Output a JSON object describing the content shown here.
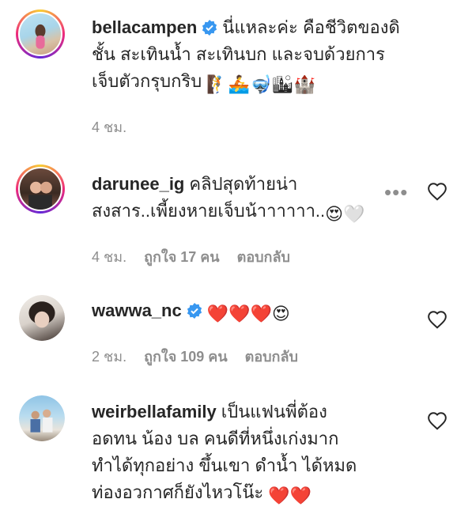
{
  "comments": [
    {
      "username": "bellacampen",
      "verified": true,
      "lines": [
        "นี่แหละค่ะ คือชีวิตของดิ",
        "ชั้น สะเทินน้ำ สะเทินบก และจบด้วยการ",
        "เจ็บตัวกรุบกริบ"
      ],
      "emoji_after": "🧗🚣🤿🏙🏰",
      "time": "4 ชม.",
      "likes": "",
      "reply": ""
    },
    {
      "username": "darunee_ig",
      "verified": false,
      "lines": [
        "คลิปสุดท้ายน่า",
        "สงสาร..เพี้ยงหายเจ็บน้าาาาาา.."
      ],
      "emoji_after": "😍🤍",
      "time": "4 ชม.",
      "likes": "ถูกใจ 17 คน",
      "reply": "ตอบกลับ",
      "more": "•••"
    },
    {
      "username": "wawwa_nc",
      "verified": true,
      "lines": [
        ""
      ],
      "emoji_after": "❤️❤️❤️😍",
      "time": "2 ชม.",
      "likes": "ถูกใจ 109 คน",
      "reply": "ตอบกลับ"
    },
    {
      "username": "weirbellafamily",
      "verified": false,
      "lines": [
        "เป็นแฟนพี่ต้อง",
        "อดทน น้อง บล คนดีที่หนึ่งเก่งมาก",
        "ทำได้ทุกอย่าง ขึ้นเขา ดำน้ำ ได้หมด",
        "ท่องอวกาศก็ยังไหวโน๊ะ"
      ],
      "emoji_after": "❤️❤️",
      "time": "",
      "likes": "",
      "reply": ""
    }
  ],
  "colors": {
    "verified": "#3897f0",
    "meta": "#8e8e8e",
    "heart": "#e0245e"
  }
}
